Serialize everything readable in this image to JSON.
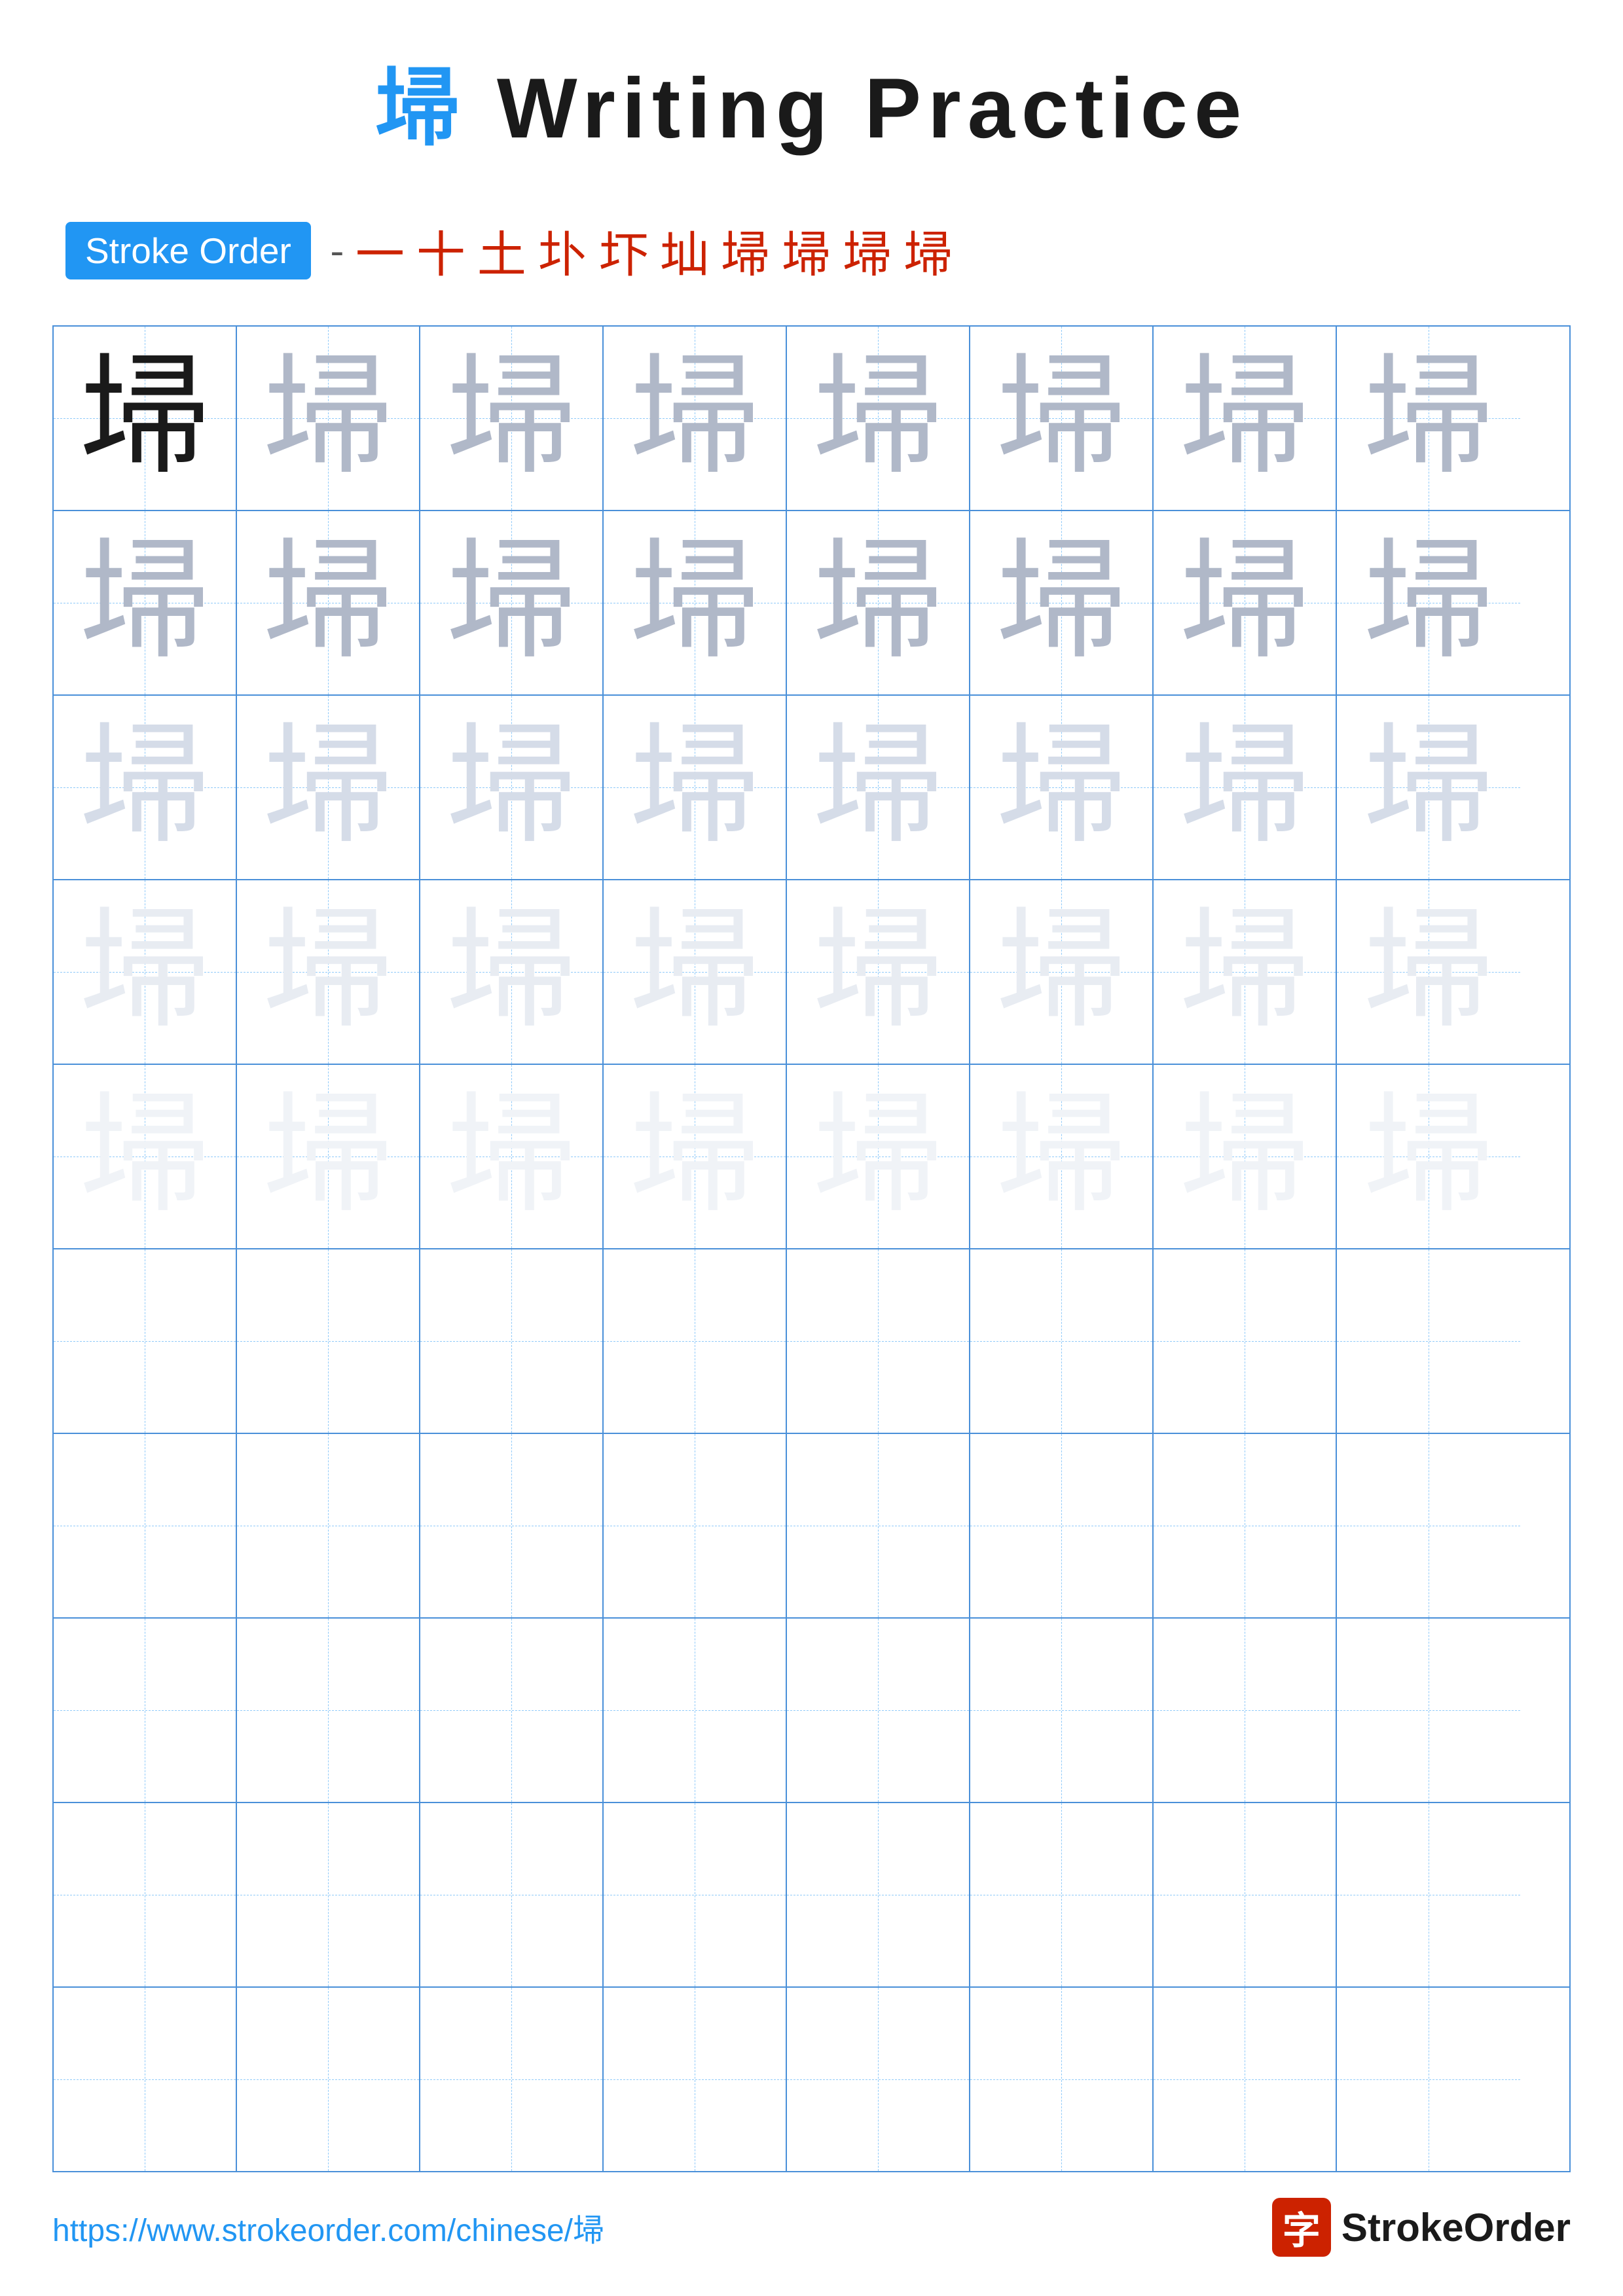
{
  "title": {
    "char": "埽",
    "rest": " Writing Practice"
  },
  "stroke_order": {
    "badge_label": "Stroke Order",
    "separator": "-",
    "strokes": [
      "一",
      "十",
      "土",
      "圤",
      "圷",
      "圸",
      "圹",
      "埽",
      "埽",
      "埽"
    ]
  },
  "grid": {
    "rows": 10,
    "cols": 8,
    "char": "埽",
    "practice_rows": 5,
    "empty_rows": 5
  },
  "footer": {
    "url": "https://www.strokeorder.com/chinese/埽",
    "logo_char": "字",
    "logo_name": "StrokeOrder"
  }
}
